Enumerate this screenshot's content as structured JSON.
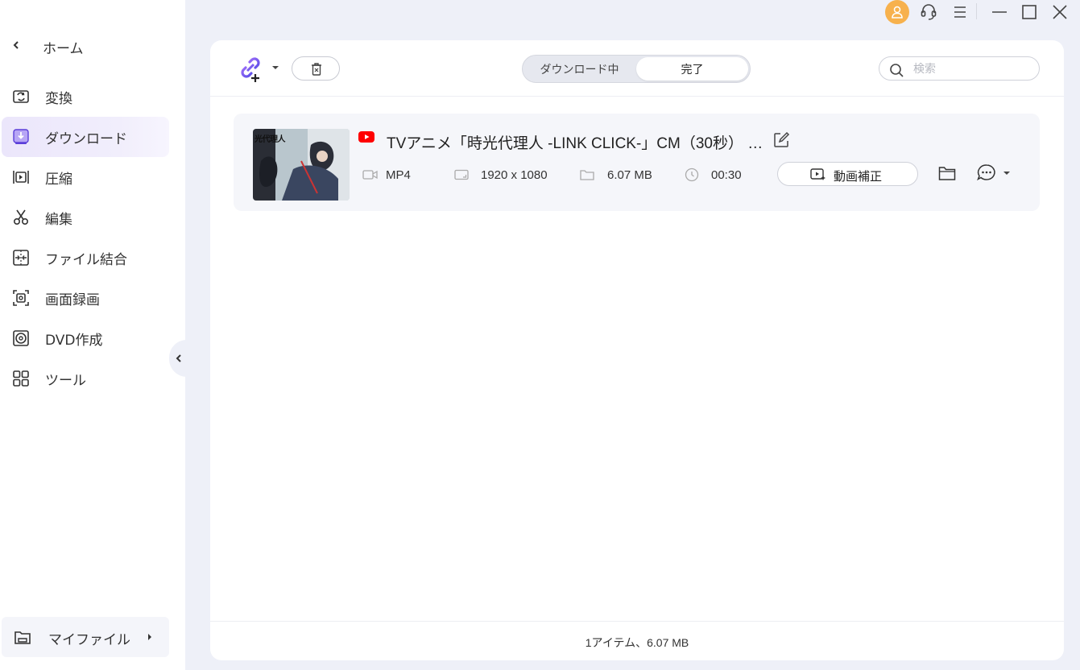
{
  "sidebar": {
    "home_label": "ホーム",
    "items": [
      {
        "label": "変換",
        "icon": "convert-icon"
      },
      {
        "label": "ダウンロード",
        "icon": "download-icon",
        "active": true
      },
      {
        "label": "圧縮",
        "icon": "compress-icon"
      },
      {
        "label": "編集",
        "icon": "scissors-icon"
      },
      {
        "label": "ファイル結合",
        "icon": "merge-icon"
      },
      {
        "label": "画面録画",
        "icon": "screen-record-icon"
      },
      {
        "label": "DVD作成",
        "icon": "dvd-icon"
      },
      {
        "label": "ツール",
        "icon": "tools-grid-icon"
      }
    ],
    "my_files_label": "マイファイル"
  },
  "titlebar": {
    "icons": [
      "user-avatar-icon",
      "headset-icon",
      "menu-icon",
      "minimize-icon",
      "maximize-icon",
      "close-icon"
    ],
    "avatar_color": "#f7b14d"
  },
  "toolbar": {
    "tabs": [
      "ダウンロード中",
      "完了"
    ],
    "active_tab": "完了",
    "search_placeholder": "検索"
  },
  "items": [
    {
      "source": "YouTube",
      "title": "TVアニメ「時光代理人 -LINK CLICK-」CM（30秒） 2...",
      "thumb_text": "光代理人",
      "format": "MP4",
      "resolution": "1920 x 1080",
      "size": "6.07 MB",
      "duration": "00:30",
      "enhance_label": "動画補正"
    }
  ],
  "status": {
    "summary": "1アイテム、6.07 MB"
  },
  "colors": {
    "accent": "#7b5cf0",
    "active_nav_bg": "#ebe6fb",
    "youtube_red": "#ff0000",
    "app_bg": "#eef0f8"
  }
}
